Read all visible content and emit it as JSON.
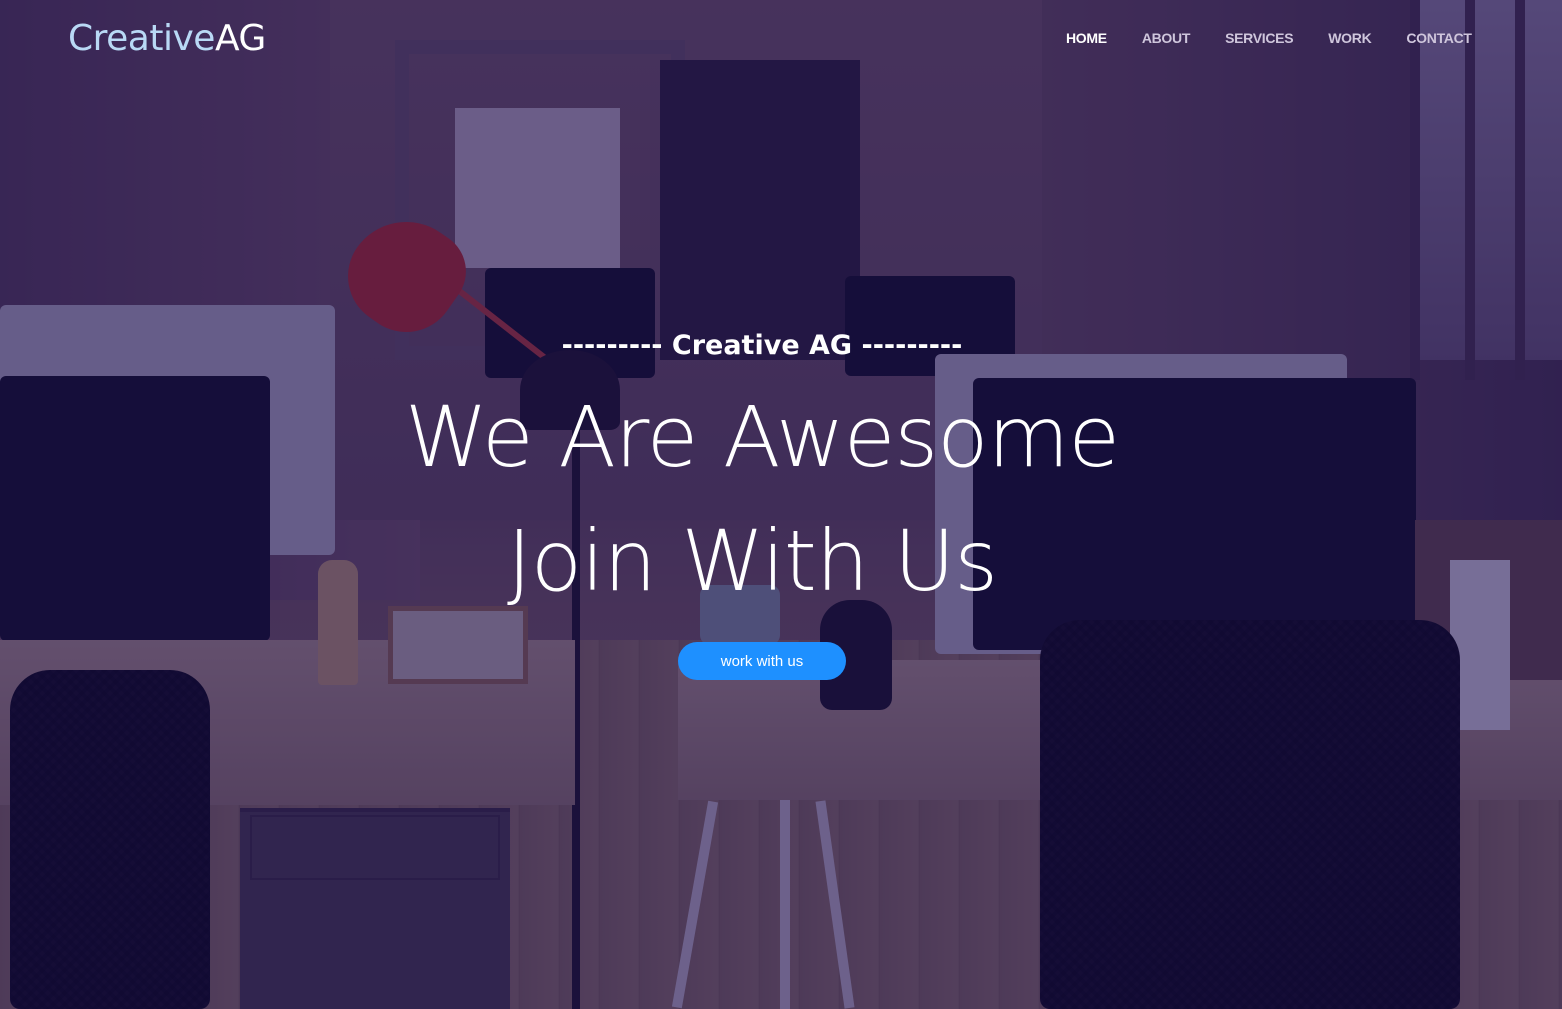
{
  "brand": {
    "logo_part1": "Creative",
    "logo_part2": "AG"
  },
  "nav": {
    "items": [
      {
        "label": "HOME",
        "active": true
      },
      {
        "label": "ABOUT",
        "active": false
      },
      {
        "label": "SERVICES",
        "active": false
      },
      {
        "label": "WORK",
        "active": false
      },
      {
        "label": "CONTACT",
        "active": false
      }
    ]
  },
  "hero": {
    "eyebrow": "--------- Creative AG ---------",
    "headline_line1": "We Are Awesome",
    "headline_line2": "Join With Us",
    "cta_label": "work with us"
  },
  "colors": {
    "overlay": "#1e125a",
    "accent_button": "#1e90ff",
    "logo_light": "#b9d9f5",
    "nav_active": "#ffffff",
    "nav_inactive": "#cfc6dc"
  }
}
